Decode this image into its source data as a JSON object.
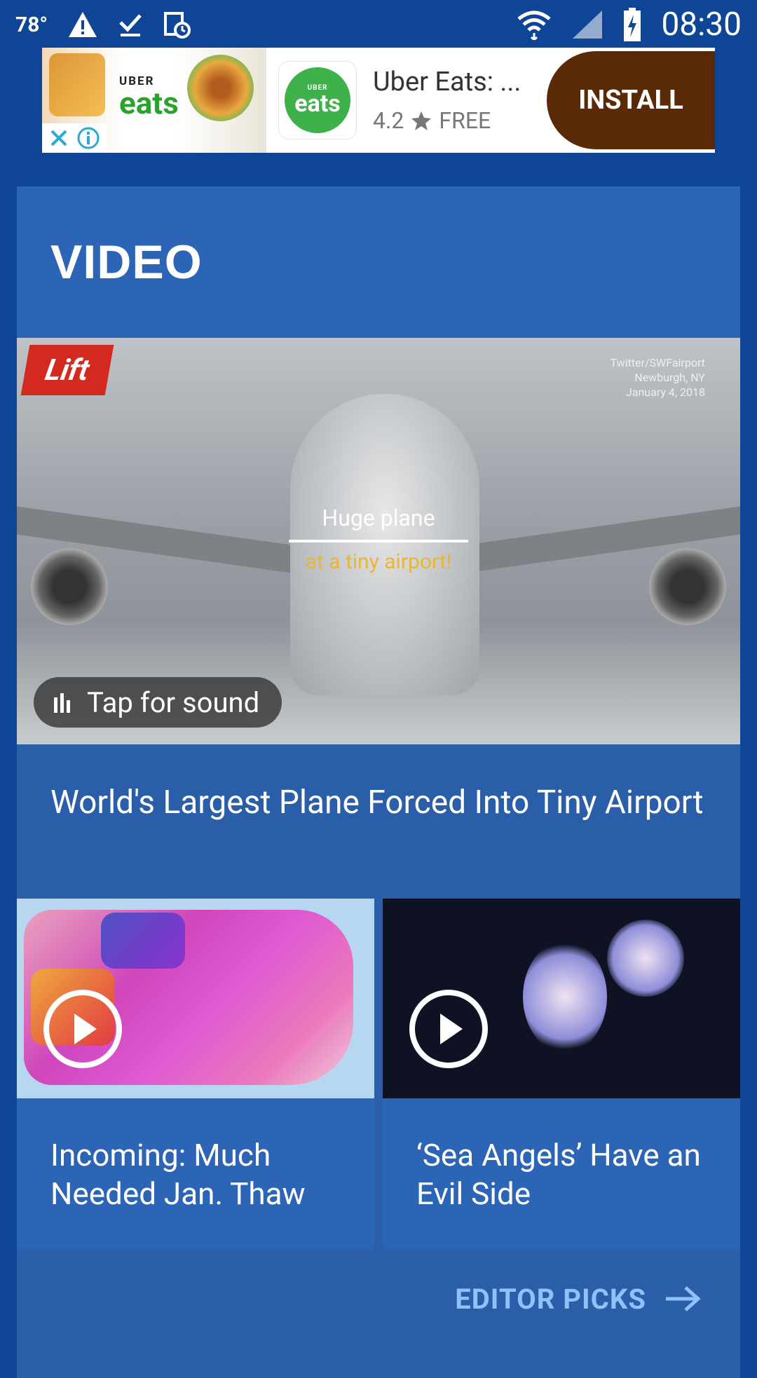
{
  "status_bar": {
    "temperature": "78°",
    "time": "08:30",
    "icons": [
      "warning-icon",
      "download-done-icon",
      "schedule-icon",
      "wifi-icon",
      "signal-icon",
      "battery-charging-icon"
    ]
  },
  "ad": {
    "brand_small": "UBER",
    "brand_large": "eats",
    "app_icon_small": "UBER",
    "app_icon_large": "eats",
    "title": "Uber Eats: ...",
    "rating": "4.2",
    "price": "FREE",
    "install_label": "INSTALL",
    "colors": {
      "install_bg": "#5a2a07",
      "eats_green": "#3fb14a"
    }
  },
  "section": {
    "title": "VIDEO"
  },
  "hero": {
    "logo_text": "Lift",
    "credit_lines": [
      "Twitter/SWFairport",
      "Newburgh, NY",
      "January 4, 2018"
    ],
    "caption_line1": "Huge plane",
    "caption_line2": "at a tiny airport!",
    "sound_label": "Tap for sound",
    "headline": "World's Largest Plane Forced Into Tiny Airport"
  },
  "tiles": [
    {
      "title": "Incoming: Much Needed Jan. Thaw"
    },
    {
      "title": "‘Sea Angels’ Have an Evil Side"
    }
  ],
  "footer": {
    "link_label": "EDITOR PICKS"
  },
  "colors": {
    "page_bg": "#0f4596",
    "card_bg": "#2a5ea9",
    "header_bg": "#2d65b6",
    "link": "#8fc1ff"
  }
}
